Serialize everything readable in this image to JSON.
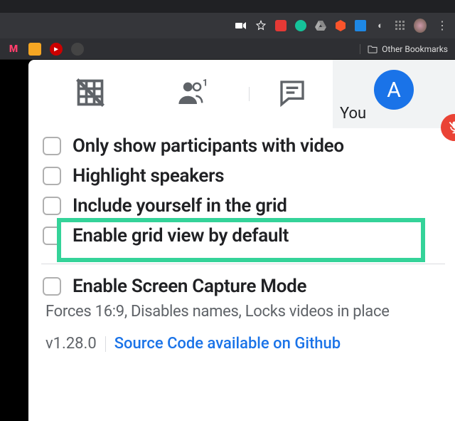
{
  "chrome": {
    "other_bookmarks": "Other Bookmarks",
    "bookmark_icons": [
      {
        "name": "myntra-bookmark",
        "bg": "transparent",
        "letter": "M",
        "color": "#ff3f6c"
      },
      {
        "name": "bookmark-y",
        "bg": "#f5a623",
        "letter": "",
        "color": "#fff"
      },
      {
        "name": "youtube-bookmark",
        "bg": "#ff0000",
        "letter": "▶",
        "color": "#fff"
      },
      {
        "name": "bookmark-dark",
        "bg": "#333",
        "letter": "",
        "color": "#fff"
      }
    ]
  },
  "participant": {
    "label": "You",
    "initial": "A"
  },
  "options": [
    {
      "key": "only_video",
      "label": "Only show participants with video"
    },
    {
      "key": "highlight_speakers",
      "label": "Highlight speakers"
    },
    {
      "key": "include_yourself",
      "label": "Include yourself in the grid"
    },
    {
      "key": "enable_default",
      "label": "Enable grid view by default"
    }
  ],
  "screen_capture": {
    "label": "Enable Screen Capture Mode",
    "desc": "Forces 16:9, Disables names, Locks videos in place"
  },
  "footer": {
    "version": "v1.28.0",
    "link": "Source Code available on Github"
  }
}
